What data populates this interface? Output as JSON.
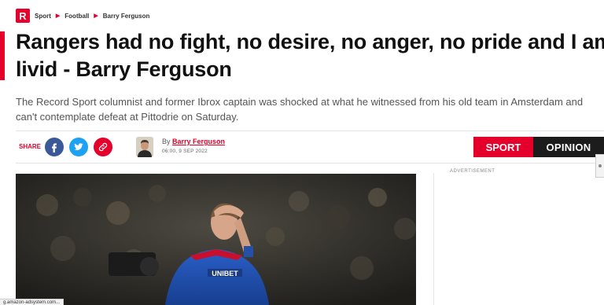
{
  "breadcrumb": {
    "logo": "R",
    "items": [
      "Sport",
      "Football",
      "Barry Ferguson"
    ]
  },
  "article": {
    "headline_line1": "Rangers had no fight, no desire, no anger, no pride and I am",
    "headline_line2": "livid - Barry Ferguson",
    "standfirst_line1": "The Record Sport columnist and former Ibrox captain was shocked at what he witnessed from his old team in Amsterdam and",
    "standfirst_line2": "can't contemplate defeat at Pittodrie on Saturday."
  },
  "share": {
    "label": "SHARE",
    "icons": [
      "facebook-icon",
      "twitter-icon",
      "link-icon"
    ]
  },
  "author": {
    "by": "By",
    "name": "Barry Ferguson",
    "timestamp": "06:00, 9 SEP 2022"
  },
  "tags": {
    "sport": "SPORT",
    "opinion": "OPINION"
  },
  "hero": {
    "shirt_text": "UNIBET"
  },
  "sidebar": {
    "ad_label": "ADVERTISEMENT"
  },
  "status_bar": {
    "text": "g.amazon-adsystem.com..."
  },
  "colors": {
    "brand_red": "#e4002b",
    "facebook": "#3b5998",
    "twitter": "#1da1f2",
    "opinion_bg": "#1c1c1c",
    "rangers_blue": "#1e4fb5"
  }
}
